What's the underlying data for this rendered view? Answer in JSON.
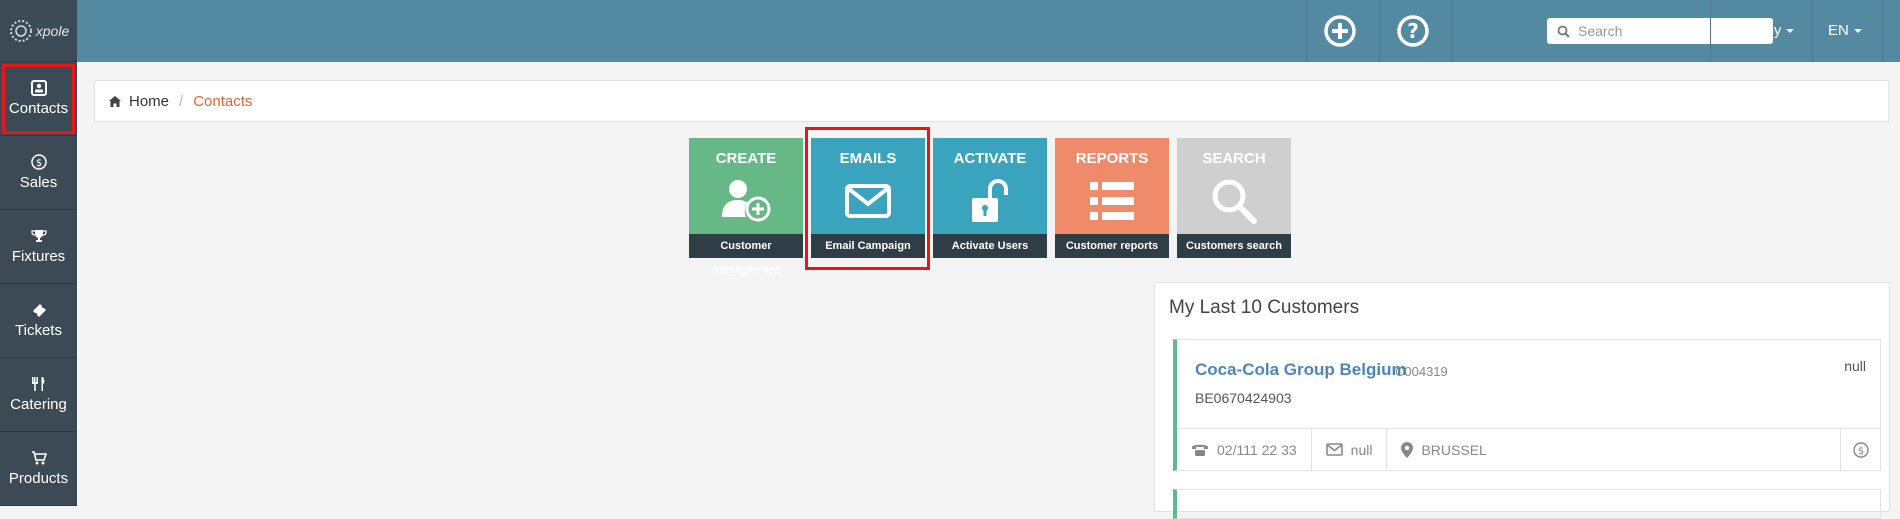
{
  "app": {
    "logo_text": "xpole"
  },
  "sidebar": {
    "items": [
      {
        "label": "Contacts",
        "icon": "contacts-icon"
      },
      {
        "label": "Sales",
        "icon": "dollar-icon"
      },
      {
        "label": "Fixtures",
        "icon": "trophy-icon"
      },
      {
        "label": "Tickets",
        "icon": "ticket-icon"
      },
      {
        "label": "Catering",
        "icon": "cutlery-icon"
      },
      {
        "label": "Products",
        "icon": "cart-icon"
      }
    ]
  },
  "topbar": {
    "search_placeholder": "Search",
    "user": "Robby",
    "language": "EN"
  },
  "breadcrumb": {
    "home": "Home",
    "current": "Contacts"
  },
  "tiles": [
    {
      "title": "CREATE",
      "caption": "Customer management",
      "color": "#66b886"
    },
    {
      "title": "EMAILS",
      "caption": "Email Campaign",
      "color": "#3aa3bd"
    },
    {
      "title": "ACTIVATE",
      "caption": "Activate Users",
      "color": "#3aa3bd"
    },
    {
      "title": "REPORTS",
      "caption": "Customer reports",
      "color": "#ef8a6a"
    },
    {
      "title": "SEARCH",
      "caption": "Customers search",
      "color": "#cfcfcf"
    }
  ],
  "panel": {
    "title": "My Last 10 Customers",
    "customer": {
      "name": "Coca-Cola Group Belgium",
      "code": "C004319",
      "vat": "BE0670424903",
      "status": "null",
      "phone": "02/111 22 33",
      "email": "null",
      "city": "BRUSSEL"
    }
  },
  "colors": {
    "topbar": "#538aa1",
    "sidebar": "#3c4a55",
    "accent": "#e0643a",
    "highlight": "#e8151b"
  }
}
